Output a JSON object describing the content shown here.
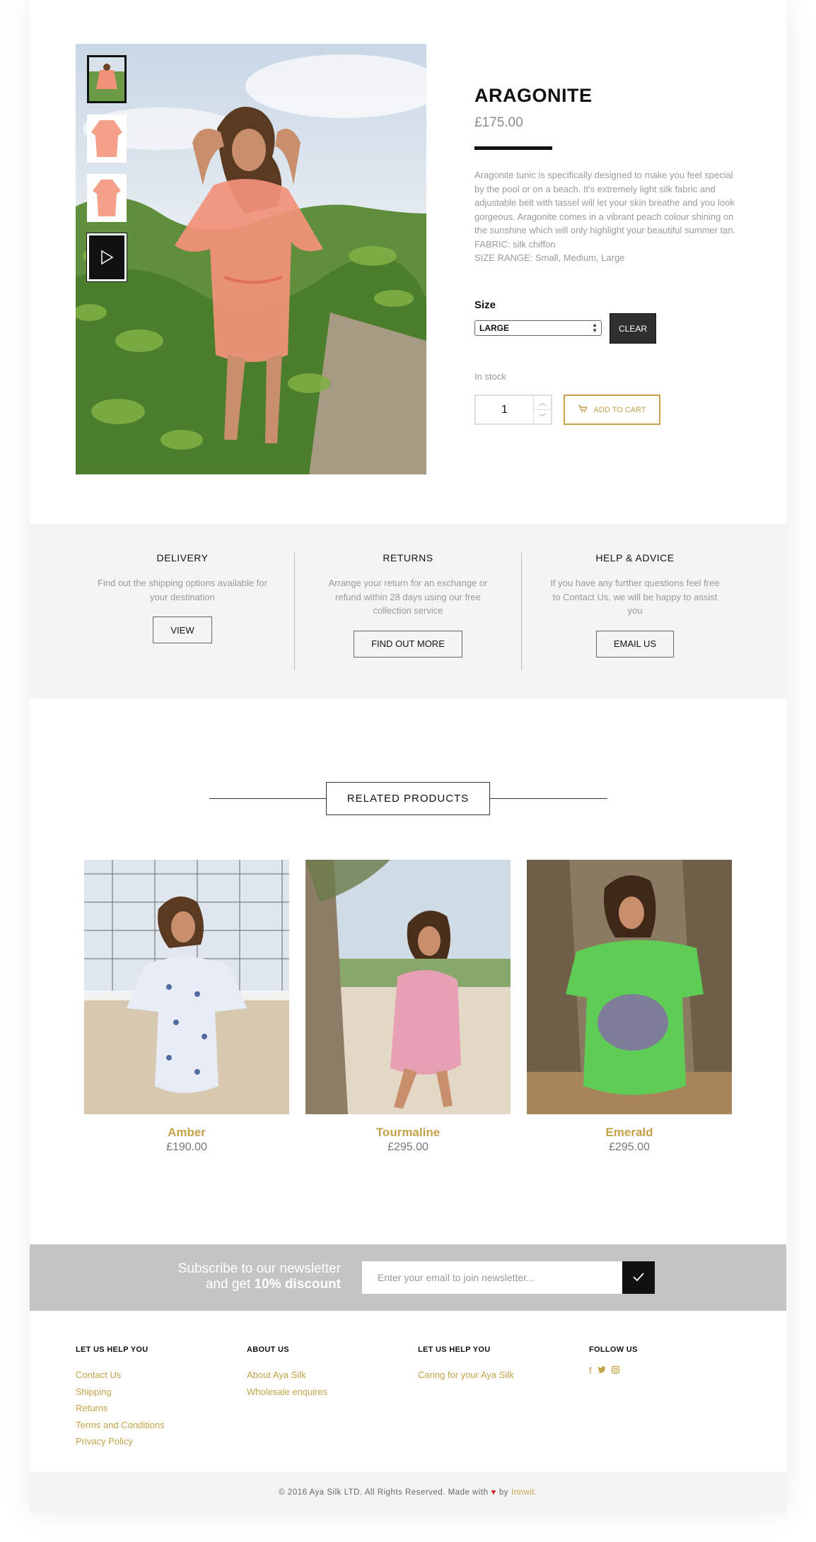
{
  "product": {
    "title": "ARAGONITE",
    "price": "£175.00",
    "description": [
      "Aragonite tunic is specifically designed to make you feel special by the pool or on a beach. It's extremely light silk fabric and adjustable belt with tassel will let your skin breathe and you look gorgeous. Aragonite comes in a vibrant peach colour shining on the sunshine which will only highlight your beautiful summer tan.",
      "FABRIC: silk chiffon",
      "SIZE RANGE: Small, Medium, Large"
    ],
    "size_label": "Size",
    "size_selected": "LARGE",
    "clear_label": "CLEAR",
    "stock": "In stock",
    "quantity": "1",
    "add_to_cart": "ADD TO CART",
    "colors": {
      "accent": "#c5a24a",
      "dress": "#f2917a"
    }
  },
  "info": [
    {
      "title": "DELIVERY",
      "text": "Find out the shipping options available for your destination",
      "button": "VIEW"
    },
    {
      "title": "RETURNS",
      "text": "Arrange your return for an exchange or refund within 28 days using our free collection service",
      "button": "FIND OUT MORE"
    },
    {
      "title": "HELP & ADVICE",
      "text": "If you have any further questions feel free to Contact Us, we will be happy to assist you",
      "button": "EMAIL US"
    }
  ],
  "related": {
    "title": "RELATED PRODUCTS",
    "items": [
      {
        "name": "Amber",
        "price": "£190.00",
        "color": "#e8ecf5"
      },
      {
        "name": "Tourmaline",
        "price": "£295.00",
        "color": "#e79fb4"
      },
      {
        "name": "Emerald",
        "price": "£295.00",
        "color": "#5fcc55"
      }
    ]
  },
  "newsletter": {
    "line1": "Subscribe to our newsletter",
    "line2_prefix": "and get ",
    "line2_bold": "10% discount",
    "placeholder": "Enter your email to join newsletter...",
    "submit_icon": "checkmark-icon"
  },
  "footer": {
    "columns": [
      {
        "heading": "LET US HELP YOU",
        "links": [
          "Contact Us",
          "Shipping",
          "Returns",
          "Terms and Conditions",
          "Privacy Policy"
        ]
      },
      {
        "heading": "ABOUT US",
        "links": [
          "About Aya Silk",
          "Wholesale enquires"
        ]
      },
      {
        "heading": "LET US HELP YOU",
        "links": [
          "Caring for your Aya Silk"
        ]
      },
      {
        "heading": "FOLLOW US",
        "social": [
          "facebook-icon",
          "twitter-icon",
          "instagram-icon"
        ]
      }
    ],
    "copyright_prefix": "© 2016 Aya Silk LTD. All Rights Reserved. Made with",
    "copyright_by": "by",
    "credit": "Innwit."
  }
}
